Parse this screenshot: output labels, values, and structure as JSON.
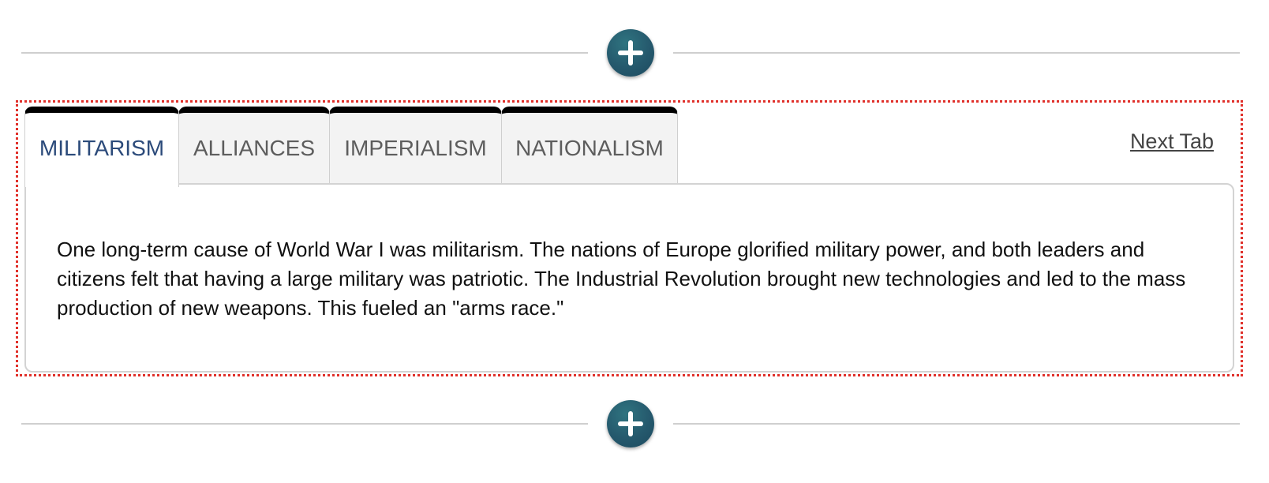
{
  "add_buttons": [
    {
      "label": "+",
      "icon": "plus-icon"
    },
    {
      "label": "+",
      "icon": "plus-icon"
    }
  ],
  "tabs": [
    {
      "label": "MILITARISM",
      "active": true
    },
    {
      "label": "ALLIANCES",
      "active": false
    },
    {
      "label": "IMPERIALISM",
      "active": false
    },
    {
      "label": "NATIONALISM",
      "active": false
    }
  ],
  "next_tab_label": "Next Tab",
  "panel": {
    "text": "One long-term cause of World War I was militarism. The nations of Europe glorified military power, and both leaders and citizens felt that having a large military was patriotic. The Industrial Revolution brought new technologies and led to the mass production of new weapons. This fueled an \"arms race.\""
  },
  "colors": {
    "add_button": "#25596d",
    "selection_outline": "#e0302a",
    "active_tab_text": "#2b4a7a",
    "tab_top_border": "#000000"
  }
}
